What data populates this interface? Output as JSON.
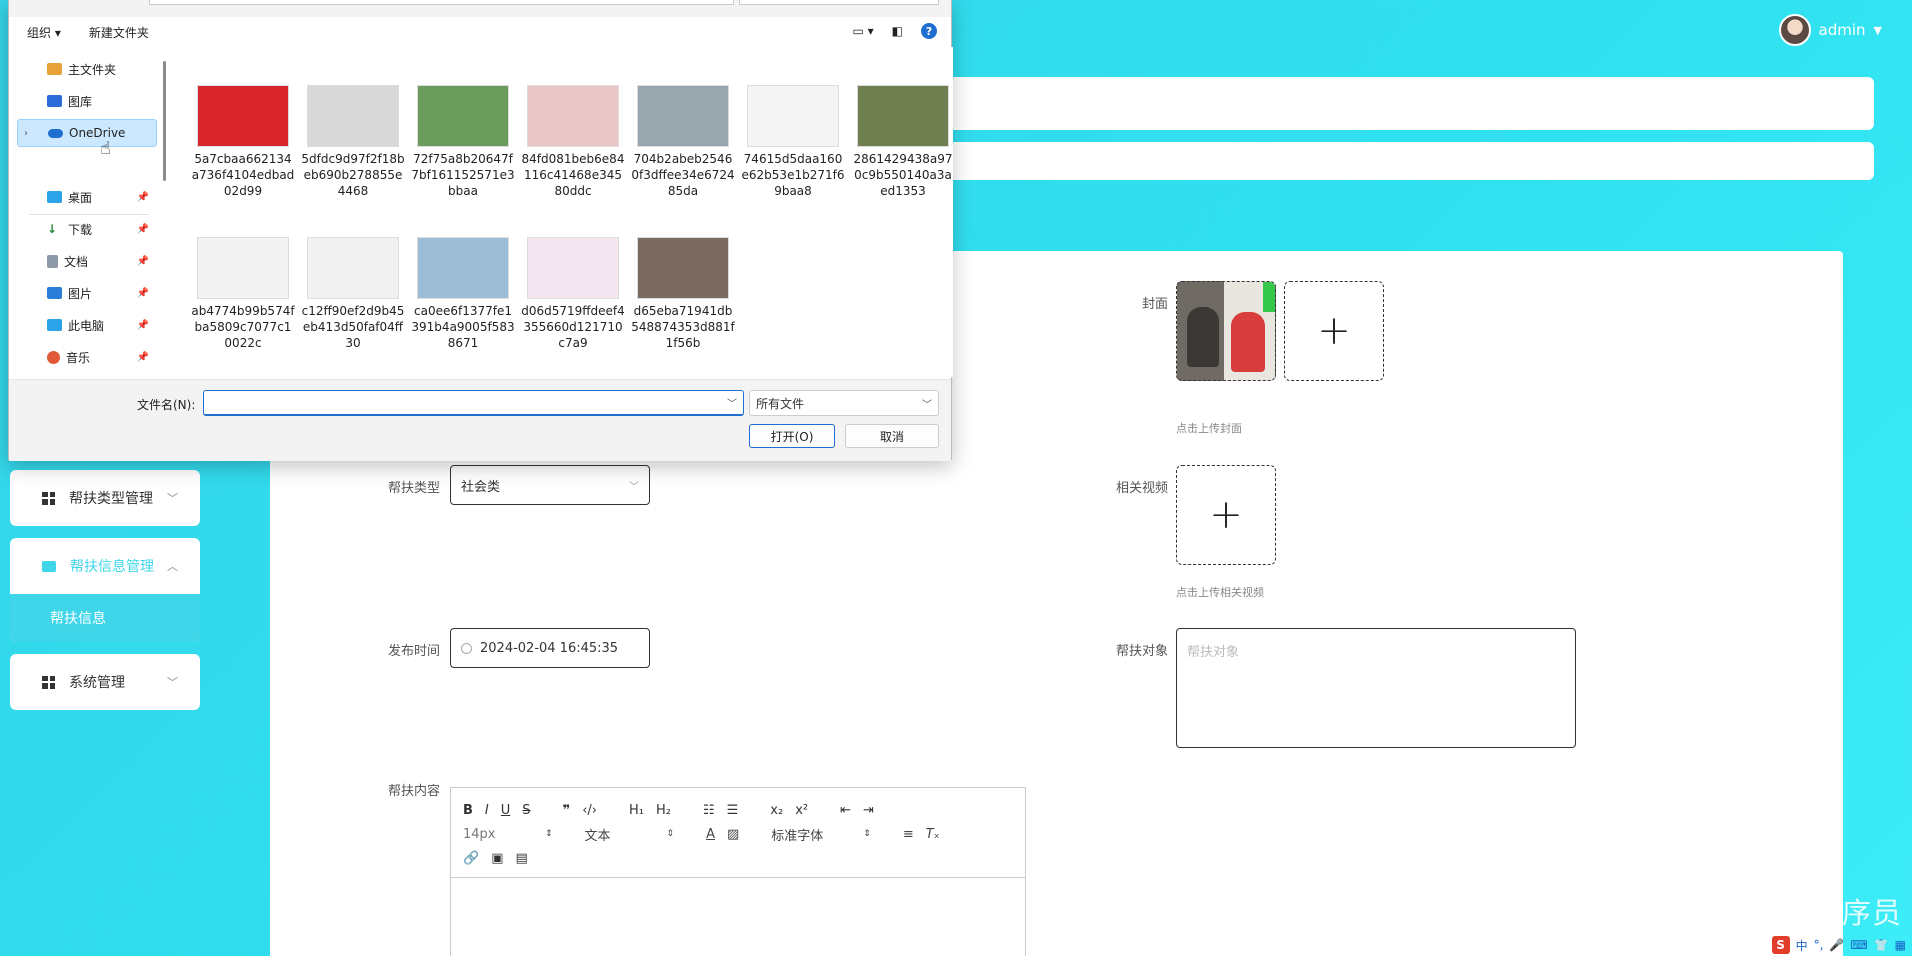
{
  "header": {
    "user": "admin"
  },
  "sidebar": {
    "items": [
      {
        "label": "帮扶类型管理"
      },
      {
        "label": "帮扶信息管理",
        "sub": "帮扶信息"
      },
      {
        "label": "系统管理"
      }
    ]
  },
  "form": {
    "type_label": "帮扶类型",
    "type_value": "社会类",
    "time_label": "发布时间",
    "time_value": "2024-02-04 16:45:35",
    "content_label": "帮扶内容",
    "cover_label": "封面",
    "cover_hint": "点击上传封面",
    "video_label": "相关视频",
    "video_hint": "点击上传相关视频",
    "target_label": "帮扶对象",
    "target_placeholder": "帮扶对象"
  },
  "editor": {
    "font_size": "14px",
    "block": "文本",
    "font": "标准字体"
  },
  "dialog": {
    "toolbar": {
      "organize": "组织",
      "new_folder": "新建文件夹"
    },
    "nav": [
      {
        "label": "主文件夹",
        "color": "#e8a23a"
      },
      {
        "label": "图库",
        "color": "#2b6cd8"
      },
      {
        "label": "OneDrive",
        "color": "#1e6fd0"
      },
      {
        "label": "桌面",
        "color": "#2aa3e8"
      },
      {
        "label": "下载",
        "color": "#2b8a3e"
      },
      {
        "label": "文档",
        "color": "#8d99a6"
      },
      {
        "label": "图片",
        "color": "#2b7ed8"
      },
      {
        "label": "此电脑",
        "color": "#2aa3e8"
      },
      {
        "label": "音乐",
        "color": "#e05a3a"
      }
    ],
    "files": [
      {
        "name": "5a7cbaa662134a736f4104edbad02d99",
        "color": "#d8262c"
      },
      {
        "name": "5dfdc9d97f2f18beb690b278855e4468",
        "color": "#d9d9d9"
      },
      {
        "name": "72f75a8b20647f7bf161152571e3bbaa",
        "color": "#6a9a5c"
      },
      {
        "name": "84fd081beb6e84116c41468e34580ddc",
        "color": "#e9c7c9"
      },
      {
        "name": "704b2abeb25460f3dffee34e672485da",
        "color": "#9aa6ad"
      },
      {
        "name": "74615d5daa160e62b53e1b271f69baa8",
        "color": "#f4f4f4"
      },
      {
        "name": "2861429438a970c9b550140a3aed1353",
        "color": "#6f7f4f"
      },
      {
        "name": "ab4774b99b574fba5809c7077c10022c",
        "color": "#f2f2f2"
      },
      {
        "name": "c12ff90ef2d9b45eb413d50faf04ff30",
        "color": "#f1f1f1"
      },
      {
        "name": "ca0ee6f1377fe1391b4a9005f5838671",
        "color": "#9dbcd6"
      },
      {
        "name": "d06d5719ffdeef4355660d121710c7a9",
        "color": "#f3e5ef"
      },
      {
        "name": "d65eba71941db548874353d881f1f56b",
        "color": "#7a6a62"
      }
    ],
    "filename_label": "文件名(N):",
    "filetype": "所有文件",
    "open": "打开(O)",
    "cancel": "取消"
  },
  "watermark": "CSDN @毕业程序员",
  "tray": {
    "ime": "中"
  }
}
